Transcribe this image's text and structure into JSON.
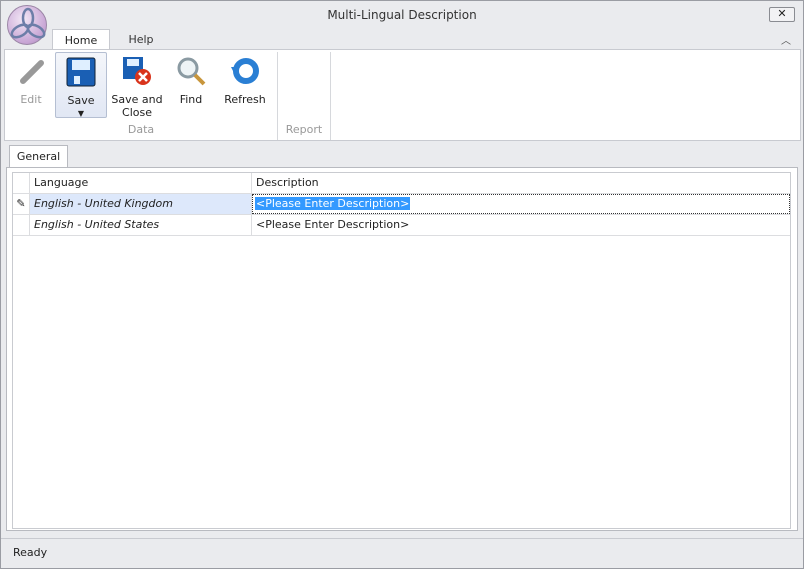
{
  "window": {
    "title": "Multi-Lingual Description",
    "close_label": "✕"
  },
  "ribbon": {
    "tabs": [
      {
        "label": "Home"
      },
      {
        "label": "Help"
      }
    ],
    "buttons": {
      "edit": "Edit",
      "save": "Save",
      "save_close_1": "Save and",
      "save_close_2": "Close",
      "find": "Find",
      "refresh": "Refresh"
    },
    "groups": {
      "data": "Data",
      "report": "Report"
    }
  },
  "page_tab": "General",
  "grid": {
    "columns": [
      "Language",
      "Description"
    ],
    "rows": [
      {
        "language": "English - United Kingdom",
        "description": "<Please Enter Description>",
        "editing": true
      },
      {
        "language": "English - United States",
        "description": "<Please Enter Description>"
      }
    ]
  },
  "status": "Ready"
}
